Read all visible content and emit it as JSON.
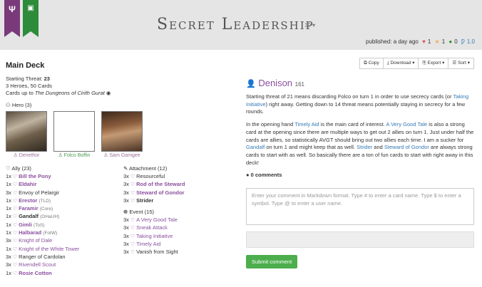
{
  "header": {
    "title": "Secret Leadership",
    "version": "10",
    "published": "published: a day ago",
    "likes": "1",
    "favorites": "1",
    "comments": "0",
    "version_badge": "1.0",
    "colors": {
      "leadership_ribbon": "#7a3a7a",
      "spirit_ribbon": "#2e8b3a"
    }
  },
  "deck": {
    "heading": "Main Deck",
    "threat_label": "Starting Threat: ",
    "threat_value": "23",
    "counts": "3 Heroes, 50 Cards",
    "cards_up_to_prefix": "Cards up to ",
    "cards_up_to_set": "The Dungeons of Cirith Gurat",
    "hero_section": "Hero (3)",
    "heroes": [
      {
        "name": "Denethor"
      },
      {
        "name": "Folco Boffin"
      },
      {
        "name": "Sam Gamgee"
      }
    ],
    "ally_section": "Ally (23)",
    "allies": [
      {
        "qty": "1x",
        "name": "Bill the Pony",
        "suffix": ""
      },
      {
        "qty": "1x",
        "name": "Eldahir",
        "suffix": ""
      },
      {
        "qty": "3x",
        "name": "Envoy of Pelargir",
        "suffix": ""
      },
      {
        "qty": "1x",
        "name": "Erestor",
        "suffix": "(TLD)"
      },
      {
        "qty": "1x",
        "name": "Faramir",
        "suffix": "(Core)"
      },
      {
        "qty": "1x",
        "name": "Gandalf",
        "suffix": "(OHaUH)"
      },
      {
        "qty": "1x",
        "name": "Gimli",
        "suffix": "(ToS)"
      },
      {
        "qty": "1x",
        "name": "Halbarad",
        "suffix": "(FotW)"
      },
      {
        "qty": "3x",
        "name": "Knight of Dale",
        "suffix": ""
      },
      {
        "qty": "1x",
        "name": "Knight of the White Tower",
        "suffix": ""
      },
      {
        "qty": "3x",
        "name": "Ranger of Cardolan",
        "suffix": ""
      },
      {
        "qty": "3x",
        "name": "Rivendell Scout",
        "suffix": ""
      },
      {
        "qty": "1x",
        "name": "Rosie Cotton",
        "suffix": ""
      }
    ],
    "attachment_section": "Attachment (12)",
    "attachments": [
      {
        "qty": "3x",
        "name": "Resourceful"
      },
      {
        "qty": "3x",
        "name": "Rod of the Steward"
      },
      {
        "qty": "3x",
        "name": "Steward of Gondor"
      },
      {
        "qty": "3x",
        "name": "Strider"
      }
    ],
    "event_section": "Event (15)",
    "events": [
      {
        "qty": "3x",
        "name": "A Very Good Tale"
      },
      {
        "qty": "3x",
        "name": "Sneak Attack"
      },
      {
        "qty": "3x",
        "name": "Taking Initiative"
      },
      {
        "qty": "3x",
        "name": "Timely Aid"
      },
      {
        "qty": "3x",
        "name": "Vanish from Sight"
      }
    ]
  },
  "toolbar": {
    "copy": "Copy",
    "download": "Download",
    "export": "Export",
    "sort": "Sort"
  },
  "author": {
    "name": "Denison",
    "reputation": "161"
  },
  "description": {
    "p1_a": "Starting threat of 21 means discarding Folco on turn 1 in order to use secrecy cards (or ",
    "p1_link": "Taking Initiative",
    "p1_b": ") right away. Getting down to 14 threat means potentially staying in secrecy for a few rounds.",
    "p2_a": "In the opening hand ",
    "p2_link1": "Timely Aid",
    "p2_b": " is the main card of interest. ",
    "p2_link2": "A Very Good Tale",
    "p2_c": " is also a strong card at the opening since there are multiple ways to get out 2 allies on turn 1. Just under half the cards are allies, so statistically AVGT should bring out two allies each time. I am a sucker for ",
    "p2_link3": "Gandalf",
    "p2_d": " on turn 1 and might keep that as well. ",
    "p2_link4": "Strider",
    "p2_e": " and ",
    "p2_link5": "Steward of Gondor",
    "p2_f": " are always strong cards to start with as well. So basically there are a ton of fun cards to start with right away in this deck!"
  },
  "comments": {
    "heading": "0 comments",
    "placeholder": "Enter your comment in Markdown format. Type # to enter a card name. Type $ to enter a symbol. Type @ to enter a user name.",
    "submit": "Submit comment"
  }
}
